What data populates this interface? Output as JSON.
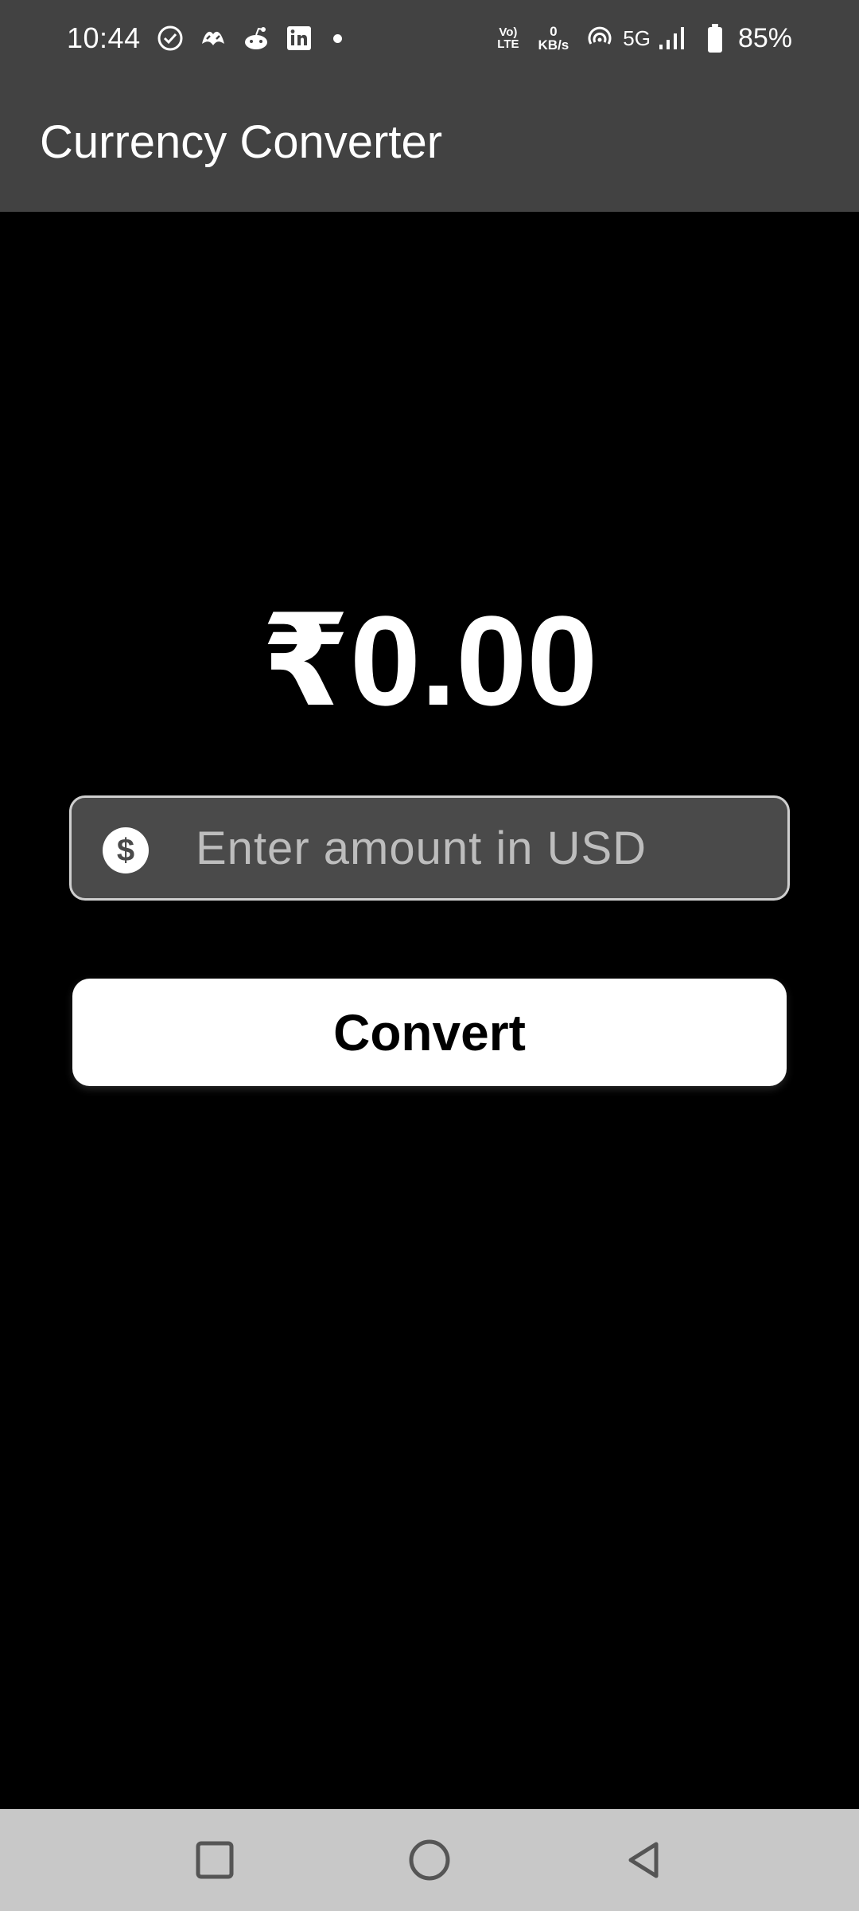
{
  "status_bar": {
    "time": "10:44",
    "notification_icons": [
      "check-circle-icon",
      "app-logo-icon",
      "reddit-icon",
      "linkedin-icon"
    ],
    "volte_top": "Vo)",
    "volte_bottom": "LTE",
    "net_speed_value": "0",
    "net_speed_unit": "KB/s",
    "network_type": "5G",
    "battery_percent": "85%"
  },
  "app_bar": {
    "title": "Currency Converter"
  },
  "main": {
    "result": "₹0.00",
    "amount_input": {
      "placeholder": "Enter amount in USD",
      "value": "",
      "icon": "dollar-icon"
    },
    "convert_label": "Convert"
  },
  "nav_bar": {
    "buttons": [
      "recents-icon",
      "home-icon",
      "back-icon"
    ]
  },
  "colors": {
    "app_bar": "#424242",
    "background": "#000000",
    "input_background": "#4a4a4a",
    "input_border": "#cfcfcf",
    "button_background": "#ffffff",
    "nav_bar": "#c8c8c8"
  }
}
